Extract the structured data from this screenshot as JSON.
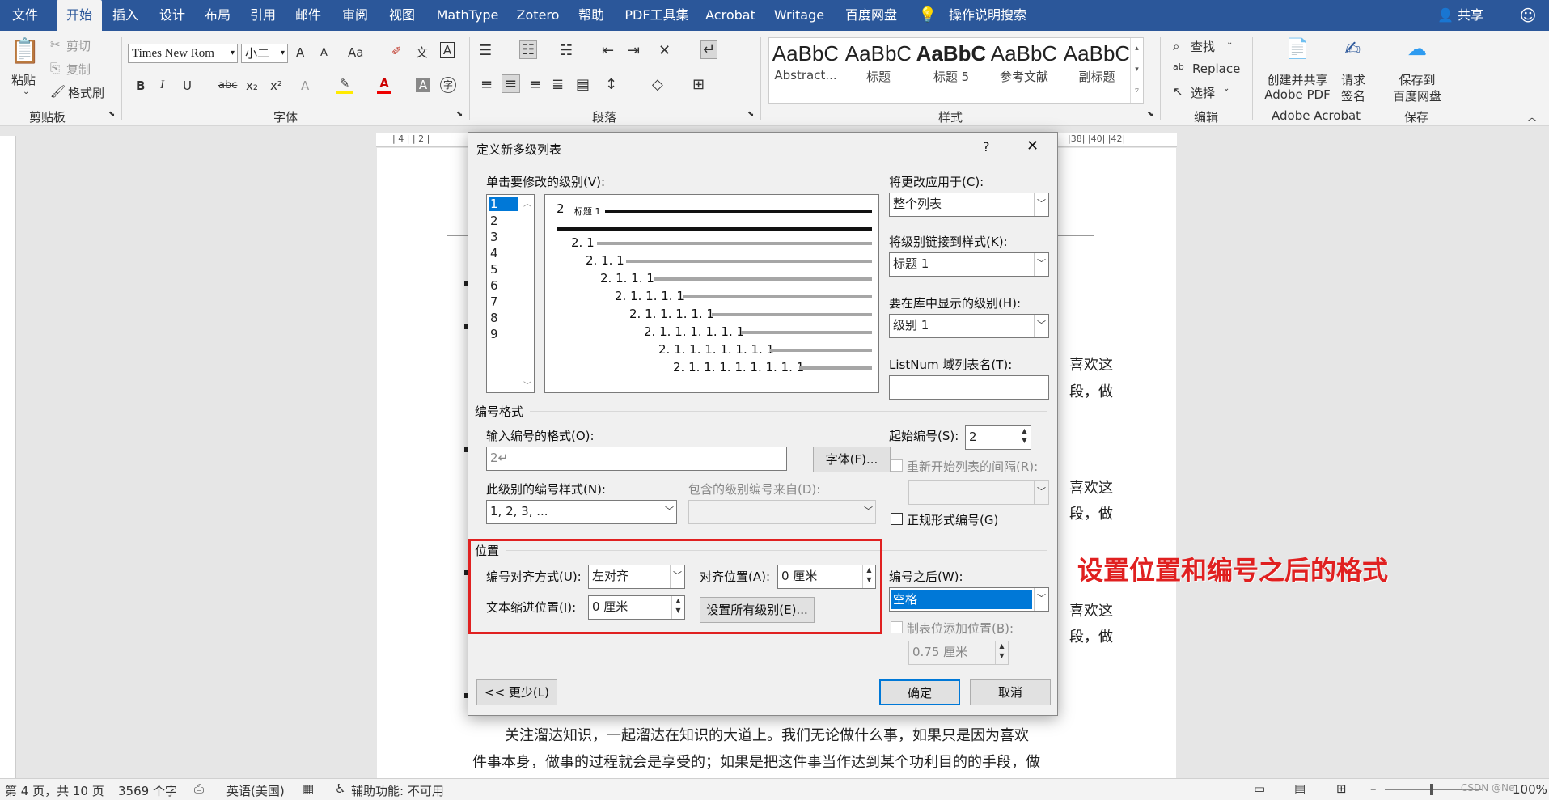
{
  "menubar": {
    "tabs": [
      "文件",
      "开始",
      "插入",
      "设计",
      "布局",
      "引用",
      "邮件",
      "审阅",
      "视图",
      "MathType",
      "Zotero",
      "帮助",
      "PDF工具集",
      "Acrobat",
      "Writage",
      "百度网盘"
    ],
    "active_tab": "开始",
    "tell_me": "操作说明搜索",
    "share": "共享"
  },
  "ribbon": {
    "clipboard": {
      "paste": "粘贴",
      "cut": "剪切",
      "copy": "复制",
      "format_painter": "格式刷",
      "group": "剪贴板"
    },
    "font": {
      "name": "Times New Rom",
      "size": "小二",
      "group": "字体",
      "bold": "B",
      "italic": "I",
      "underline": "U",
      "strike": "abc",
      "sub": "x₂",
      "sup": "x²",
      "grow": "A",
      "shrink": "A",
      "case": "Aa",
      "color_a": "A"
    },
    "paragraph": {
      "group": "段落"
    },
    "styles": {
      "group": "样式",
      "items": [
        {
          "preview": "AaBbC",
          "label": "Abstract..."
        },
        {
          "preview": "AaBbC",
          "label": "标题"
        },
        {
          "preview": "AaBbC",
          "label": "标题 5"
        },
        {
          "preview": "AaBbC",
          "label": "参考文献"
        },
        {
          "preview": "AaBbC",
          "label": "副标题"
        }
      ]
    },
    "editing": {
      "find": "查找",
      "replace": "Replace",
      "select": "选择",
      "group": "编辑"
    },
    "acrobat": {
      "create": "创建并共享\nAdobe PDF",
      "create_l1": "创建并共享",
      "create_l2": "Adobe PDF",
      "sign_l1": "请求",
      "sign_l2": "签名",
      "group": "Adobe Acrobat"
    },
    "save": {
      "l1": "保存到",
      "l2": "百度网盘",
      "group": "保存"
    }
  },
  "ruler": {
    "left_marks": "| 4 |  | 2 |",
    "right_marks": "|38|  |40|  |42|"
  },
  "document": {
    "text_right_1": "喜欢这",
    "text_right_2": "段，做",
    "text_right_3": "喜欢这",
    "text_right_4": "段，做",
    "text_right_5": "喜欢这",
    "text_right_6": "段，做",
    "para_line1": "关注溜达知识，一起溜达在知识的大道上。我们无论做什么事，如果只是因为喜欢",
    "para_line2": "件事本身，做事的过程就会是享受的；如果是把这件事当作达到某个功利目的的手段，做"
  },
  "status": {
    "page": "第 4 页，共 10 页",
    "words": "3569 个字",
    "lang": "英语(美国)",
    "access": "辅助功能: 不可用",
    "zoom": "100%",
    "watermark": "CSDN @Ne"
  },
  "dialog": {
    "title": "定义新多级列表",
    "help": "?",
    "close": "✕",
    "click_level_label": "单击要修改的级别(V):",
    "levels": [
      "1",
      "2",
      "3",
      "4",
      "5",
      "6",
      "7",
      "8",
      "9"
    ],
    "preview": {
      "heading_num": "2",
      "heading_text": "标题 1",
      "rows": [
        "2. 1",
        "2. 1. 1",
        "2. 1. 1. 1",
        "2. 1. 1. 1. 1",
        "2. 1. 1. 1. 1. 1",
        "2. 1. 1. 1. 1. 1. 1",
        "2. 1. 1. 1. 1. 1. 1. 1",
        "2. 1. 1. 1. 1. 1. 1. 1. 1"
      ]
    },
    "apply_to_label": "将更改应用于(C):",
    "apply_to_value": "整个列表",
    "link_style_label": "将级别链接到样式(K):",
    "link_style_value": "标题 1",
    "gallery_level_label": "要在库中显示的级别(H):",
    "gallery_level_value": "级别 1",
    "listnum_label": "ListNum 域列表名(T):",
    "listnum_value": "",
    "number_format_section": "编号格式",
    "enter_format_label": "输入编号的格式(O):",
    "enter_format_value": "2↵",
    "font_button": "字体(F)...",
    "start_at_label": "起始编号(S):",
    "start_at_value": "2",
    "restart_label": "重新开始列表的间隔(R):",
    "number_style_label": "此级别的编号样式(N):",
    "number_style_value": "1, 2, 3, ...",
    "include_from_label": "包含的级别编号来自(D):",
    "legal_label": "正规形式编号(G)",
    "position_section": "位置",
    "alignment_label": "编号对齐方式(U):",
    "alignment_value": "左对齐",
    "aligned_at_label": "对齐位置(A):",
    "aligned_at_value": "0 厘米",
    "text_indent_label": "文本缩进位置(I):",
    "text_indent_value": "0 厘米",
    "set_all_button": "设置所有级别(E)...",
    "follow_label": "编号之后(W):",
    "follow_value": "空格",
    "tab_stop_label": "制表位添加位置(B):",
    "tab_stop_value": "0.75 厘米",
    "less_button": "<< 更少(L)",
    "ok_button": "确定",
    "cancel_button": "取消"
  },
  "annotation": {
    "text": "设置位置和编号之后的格式",
    "color": "#e02020"
  },
  "colors": {
    "word_blue": "#2b579a",
    "highlight": "#0078d7",
    "annot_red": "#e02020"
  }
}
